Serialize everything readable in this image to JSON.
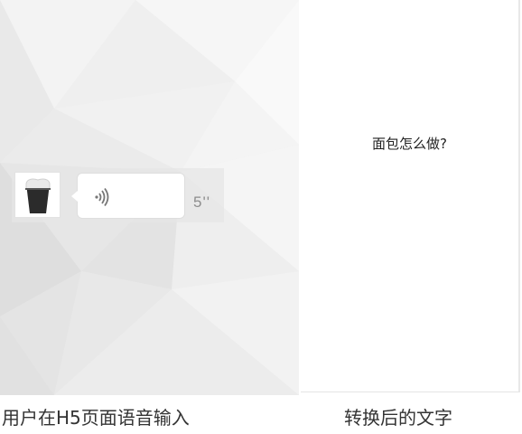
{
  "left_panel": {
    "voice_message": {
      "avatar_icon": "beer-glass-icon",
      "wave_icon": "sound-wave-icon",
      "duration": "5''"
    },
    "caption": "用户在H5页面语音输入"
  },
  "right_panel": {
    "converted_text": "面包怎么做?",
    "caption": "转换后的文字"
  },
  "colors": {
    "background": "#ececec",
    "bubble": "#ffffff",
    "duration_text": "#8d8d8d"
  }
}
